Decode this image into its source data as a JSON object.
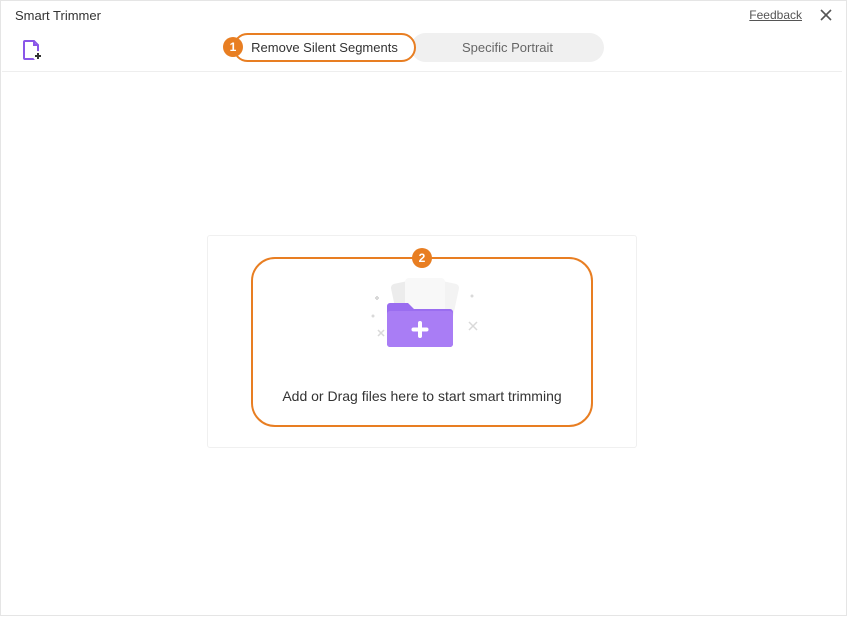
{
  "window": {
    "title": "Smart Trimmer",
    "feedback": "Feedback"
  },
  "tabs": {
    "active": "Remove Silent Segments",
    "inactive": "Specific Portrait"
  },
  "steps": {
    "one": "1",
    "two": "2"
  },
  "dropzone": {
    "text": "Add or Drag files here to start smart trimming"
  }
}
